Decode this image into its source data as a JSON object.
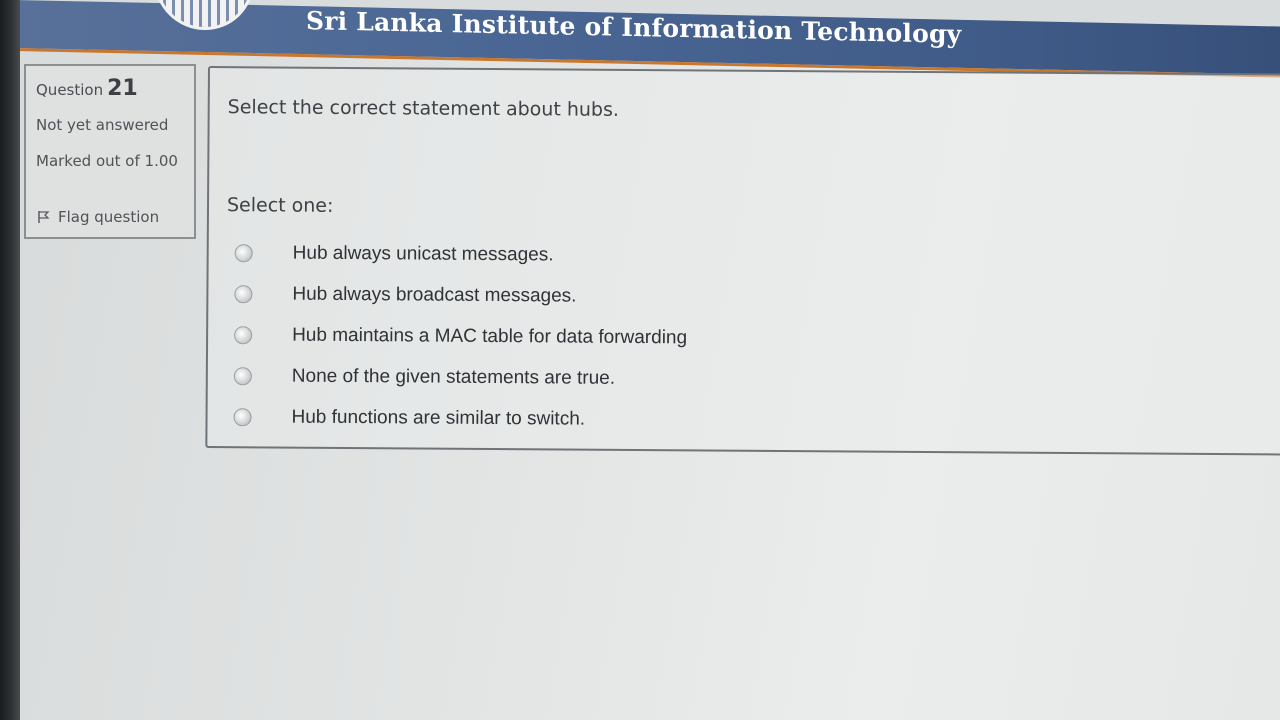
{
  "header": {
    "site_title": "Sri Lanka Institute of Information Technology"
  },
  "question_info": {
    "label": "Question",
    "number": "21",
    "status": "Not yet answered",
    "marked_out_of": "Marked out of 1.00",
    "flag_label": "Flag question"
  },
  "question": {
    "text": "Select the correct statement about hubs.",
    "prompt": "Select one:",
    "options": [
      {
        "label": "Hub always unicast messages.",
        "selected": false
      },
      {
        "label": "Hub always broadcast messages.",
        "selected": false
      },
      {
        "label": "Hub maintains a MAC table for data forwarding",
        "selected": false
      },
      {
        "label": "None of the given statements are true.",
        "selected": false
      },
      {
        "label": "Hub functions are similar to switch.",
        "selected": false
      }
    ]
  },
  "colors": {
    "header_bg": "#4a6694",
    "header_border": "#c8772f",
    "page_bg": "#e4e6e6",
    "text": "#3e4246"
  }
}
